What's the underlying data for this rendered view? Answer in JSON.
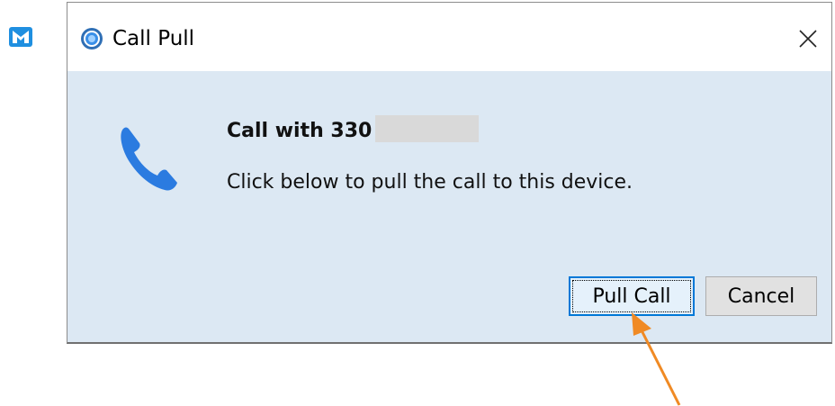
{
  "app": {
    "logo_icon": "app-logo-icon"
  },
  "dialog": {
    "title": "Call Pull",
    "title_icon": "app-circle-icon",
    "close_icon": "close-icon",
    "heading_prefix": "Call with 330",
    "message": "Click below to pull the call to this device.",
    "phone_icon": "phone-icon",
    "buttons": {
      "pull_call": "Pull Call",
      "cancel": "Cancel"
    }
  },
  "annotation": {
    "arrow_icon": "arrow-icon",
    "arrow_color": "#f08a24"
  },
  "colors": {
    "accent": "#0078d7",
    "phone": "#2b7be0",
    "content_bg": "#dce8f3"
  }
}
